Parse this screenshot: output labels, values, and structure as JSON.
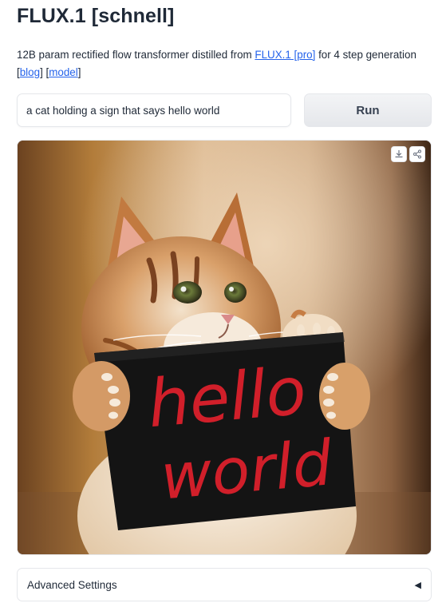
{
  "header": {
    "title": "FLUX.1 [schnell]"
  },
  "description": {
    "text_before": "12B param rectified flow transformer distilled from ",
    "link_flux_pro": "FLUX.1 [pro]",
    "text_after": " for 4 step generation",
    "bracket_open_1": "[",
    "link_blog": "blog",
    "bracket_mid": "] [",
    "link_model": "model",
    "bracket_close": "]"
  },
  "prompt": {
    "value": "a cat holding a sign that says hello world",
    "placeholder": ""
  },
  "run_button": {
    "label": "Run"
  },
  "result_image": {
    "sign_line_1": "hello",
    "sign_line_2": "world",
    "download_icon": "download-icon",
    "share_icon": "share-icon"
  },
  "advanced_settings": {
    "label": "Advanced Settings",
    "arrow": "◀"
  },
  "colors": {
    "link": "#2563eb",
    "sign_text": "#d11f2a",
    "border": "#e5e7eb"
  }
}
